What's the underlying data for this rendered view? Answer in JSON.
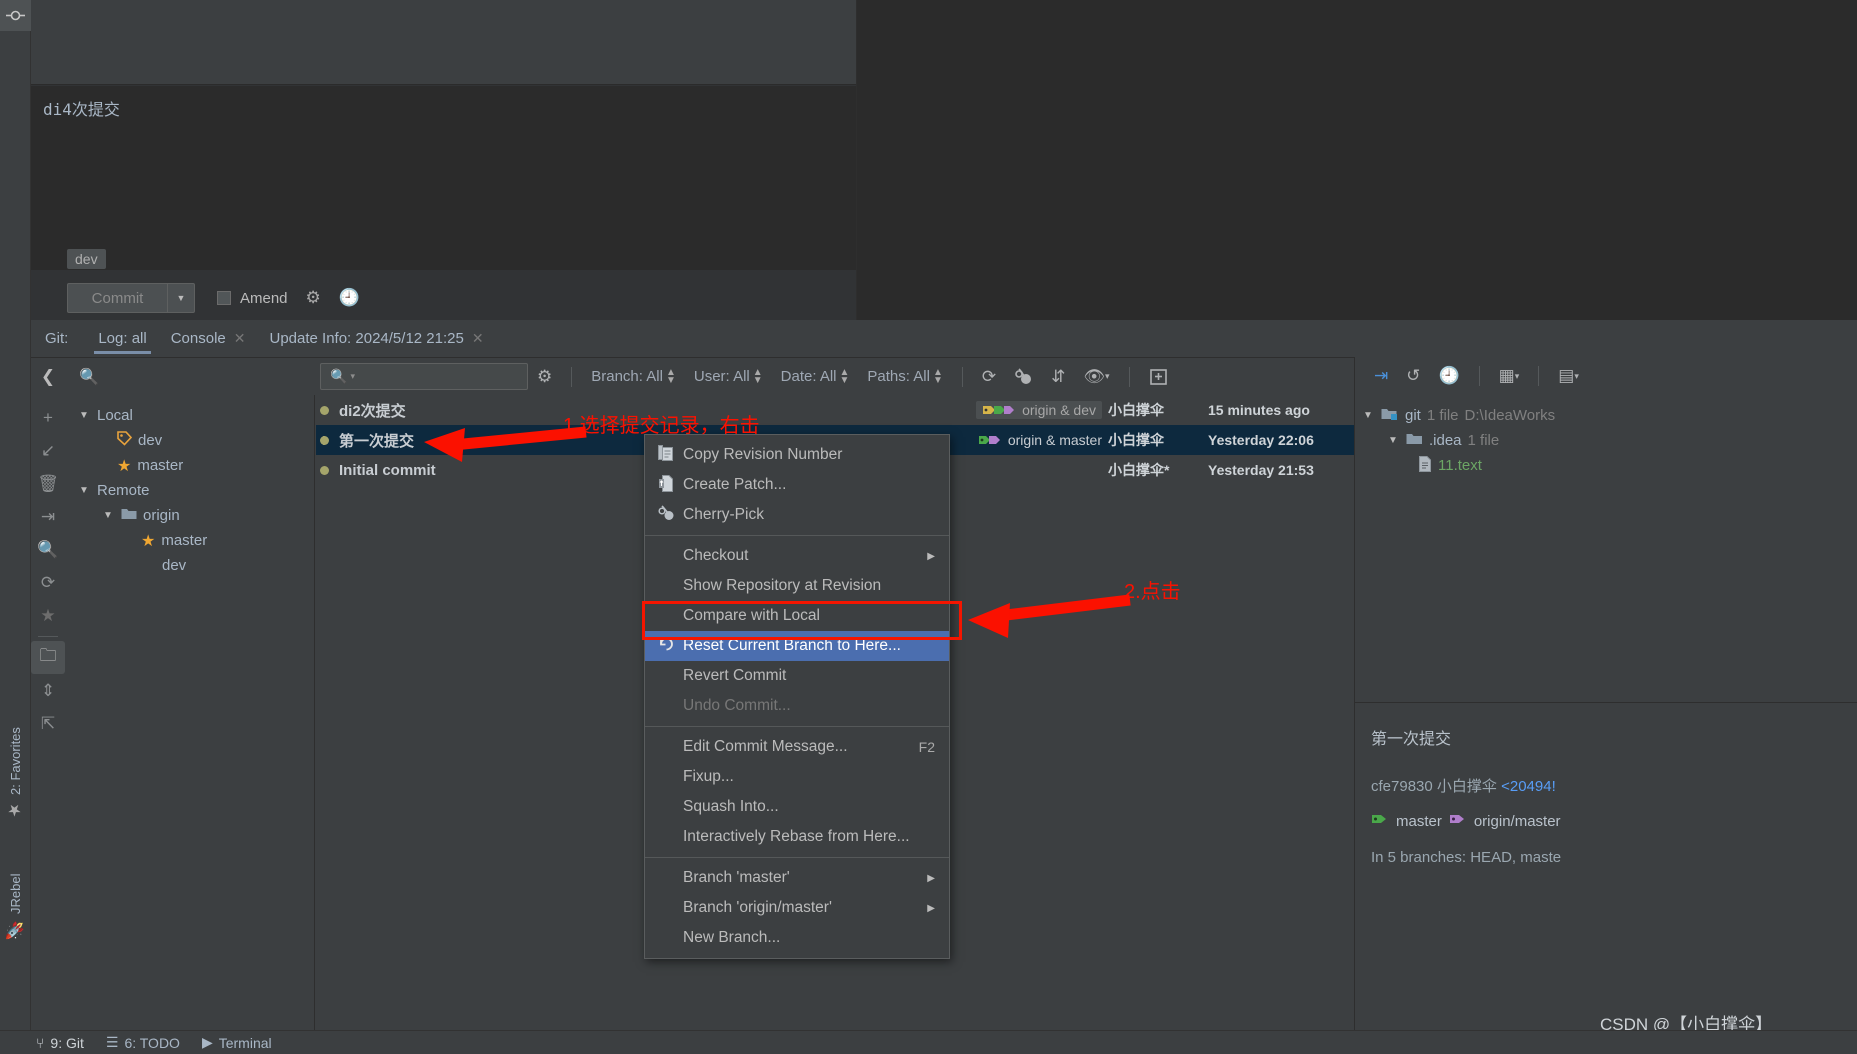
{
  "left_strip": {
    "vcs_icon": "vcs-branch-icon",
    "favorites_label": "2: Favorites",
    "jrebel_label": "JRebel"
  },
  "commit_panel": {
    "message": "di4次提交",
    "branch_chip": "dev",
    "commit_button": "Commit",
    "amend_label": "Amend",
    "settings_icon": "gear-icon",
    "history_icon": "clock-icon"
  },
  "git_tabs": {
    "prefix": "Git:",
    "tabs": [
      {
        "label": "Log: all",
        "closable": false,
        "active": true
      },
      {
        "label": "Console",
        "closable": true,
        "active": false
      },
      {
        "label": "Update Info: 2024/5/12 21:25",
        "closable": true,
        "active": false
      }
    ]
  },
  "log_toolbar": {
    "collapse_icon": "chevron-left-icon",
    "branch_search_placeholder": "",
    "search_placeholder": "",
    "search_icon": "search-icon",
    "gear_icon": "gear-icon",
    "filters": [
      {
        "name": "Branch",
        "value": "All"
      },
      {
        "name": "User",
        "value": "All"
      },
      {
        "name": "Date",
        "value": "All"
      },
      {
        "name": "Paths",
        "value": "All"
      }
    ],
    "icons": [
      "refresh-icon",
      "cherry-pick-icon",
      "sort-icon",
      "eye-icon",
      "open-tab-icon"
    ],
    "right_search_icon": "search-icon"
  },
  "branch_tree": [
    {
      "label": "Local",
      "type": "group",
      "indent": 0,
      "expanded": true
    },
    {
      "label": "dev",
      "type": "branch-tag",
      "indent": 1
    },
    {
      "label": "master",
      "type": "branch-star",
      "indent": 1
    },
    {
      "label": "Remote",
      "type": "group",
      "indent": 0,
      "expanded": true
    },
    {
      "label": "origin",
      "type": "folder",
      "indent": 1,
      "expanded": true
    },
    {
      "label": "master",
      "type": "branch-star",
      "indent": 2
    },
    {
      "label": "dev",
      "type": "plain",
      "indent": 2
    }
  ],
  "log_side_icons": [
    "add-icon",
    "fetch-icon",
    "delete-icon",
    "merge-icon",
    "search-icon",
    "refresh-icon",
    "star-icon",
    "folder-icon",
    "expand-icon",
    "collapse-icon"
  ],
  "commits": [
    {
      "subject": "di2次提交",
      "refs": [
        {
          "text": "origin & dev",
          "style": "boxed",
          "colors": [
            "#d6b54a",
            "#4aa84a",
            "#b07ecb"
          ]
        }
      ],
      "author": "小白撑伞",
      "date": "15 minutes ago",
      "selected": false
    },
    {
      "subject": "第一次提交",
      "refs": [
        {
          "text": "origin & master",
          "style": "plain",
          "colors": [
            "#4aa84a",
            "#b07ecb"
          ]
        }
      ],
      "author": "小白撑伞",
      "date": "Yesterday 22:06",
      "selected": true
    },
    {
      "subject": "Initial commit",
      "refs": [],
      "author": "小白撑伞*",
      "date": "Yesterday 21:53",
      "selected": false
    }
  ],
  "context_menu": [
    {
      "label": "Copy Revision Number",
      "icon": "copy-icon",
      "type": "item"
    },
    {
      "label": "Create Patch...",
      "icon": "patch-icon",
      "type": "item"
    },
    {
      "label": "Cherry-Pick",
      "icon": "cherry-icon",
      "type": "item"
    },
    {
      "type": "separator"
    },
    {
      "label": "Checkout",
      "icon": "",
      "type": "submenu"
    },
    {
      "label": "Show Repository at Revision",
      "icon": "",
      "type": "item"
    },
    {
      "label": "Compare with Local",
      "icon": "",
      "type": "item"
    },
    {
      "label": "Reset Current Branch to Here...",
      "icon": "reset-icon",
      "type": "item",
      "selected": true
    },
    {
      "label": "Revert Commit",
      "icon": "",
      "type": "item"
    },
    {
      "label": "Undo Commit...",
      "icon": "",
      "type": "item",
      "disabled": true
    },
    {
      "type": "separator"
    },
    {
      "label": "Edit Commit Message...",
      "icon": "",
      "type": "item",
      "shortcut": "F2"
    },
    {
      "label": "Fixup...",
      "icon": "",
      "type": "item"
    },
    {
      "label": "Squash Into...",
      "icon": "",
      "type": "item"
    },
    {
      "label": "Interactively Rebase from Here...",
      "icon": "",
      "type": "item"
    },
    {
      "type": "separator"
    },
    {
      "label": "Branch 'master'",
      "icon": "",
      "type": "submenu"
    },
    {
      "label": "Branch 'origin/master'",
      "icon": "",
      "type": "submenu"
    },
    {
      "label": "New Branch...",
      "icon": "",
      "type": "item"
    }
  ],
  "annotations": [
    {
      "text": "1.选择提交记录，右击",
      "color": "#fb1100"
    },
    {
      "text": "2.点击",
      "color": "#fb1100"
    }
  ],
  "details_toolbar_icons": [
    "collapse-arrows-icon",
    "undo-icon",
    "clock-icon",
    "grid-view-icon",
    "list-view-icon"
  ],
  "details": {
    "file_tree": [
      {
        "label": "git",
        "meta": "1 file",
        "path": "D:\\IdeaWorks",
        "type": "module",
        "indent": 0
      },
      {
        "label": ".idea",
        "meta": "1 file",
        "path": "",
        "type": "folder",
        "indent": 1
      },
      {
        "label": "11.text",
        "meta": "",
        "path": "",
        "type": "file",
        "indent": 2
      }
    ],
    "commit_subject": "第一次提交",
    "commit_hash": "cfe79830",
    "commit_author": "小白撑伞",
    "commit_email": "<20494!",
    "refs": [
      {
        "label": "master",
        "color": "#4aa84a"
      },
      {
        "label": "origin/master",
        "color": "#b07ecb"
      }
    ],
    "branches_line": "In 5 branches: HEAD, maste",
    "watermark": "CSDN @【小白撑伞】"
  },
  "status_bar": [
    {
      "label": "9: Git",
      "icon": "git-icon",
      "active": true
    },
    {
      "label": "6: TODO",
      "icon": "todo-icon",
      "active": false
    },
    {
      "label": "Terminal",
      "icon": "terminal-icon",
      "active": false
    }
  ]
}
